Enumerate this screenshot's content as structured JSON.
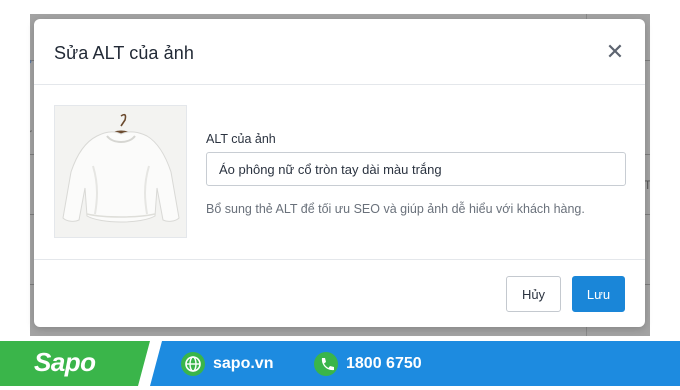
{
  "modal": {
    "title": "Sửa ALT của ảnh",
    "close_symbol": "✕",
    "image_description": "white long-sleeve crew-neck top on a hanger",
    "field_label": "ALT của ảnh",
    "alt_value": "Áo phông nữ cổ tròn tay dài màu trắng",
    "help_text": "Bổ sung thẻ ALT để tối ưu SEO và giúp ảnh dễ hiểu với khách hàng.",
    "cancel_label": "Hủy",
    "save_label": "Lưu"
  },
  "promo": {
    "brand": "Sapo",
    "website": "sapo.vn",
    "hotline": "1800 6750"
  },
  "colors": {
    "primary": "#1a86d8",
    "promo_green": "#3ab54a",
    "promo_blue": "#1d8be0"
  },
  "icons": {
    "close": "close-icon",
    "web": "globe-icon",
    "phone": "phone-icon"
  }
}
